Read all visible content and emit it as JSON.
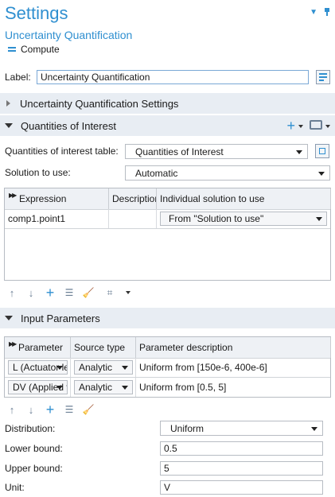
{
  "header": {
    "title": "Settings",
    "subtitle": "Uncertainty Quantification",
    "compute_label": "Compute"
  },
  "label_field": {
    "label": "Label:",
    "value": "Uncertainty Quantification"
  },
  "sections": {
    "uq_settings": "Uncertainty Quantification Settings",
    "qoi": "Quantities of Interest",
    "input_params": "Input Parameters"
  },
  "qoi": {
    "table_label": "Quantities of interest table:",
    "table_value": "Quantities of Interest",
    "solution_label": "Solution to use:",
    "solution_value": "Automatic",
    "columns": [
      "Expression",
      "Description",
      "Individual solution to use"
    ],
    "rows": [
      {
        "expression": "comp1.point1",
        "description": "",
        "solution": "From \"Solution to use\""
      }
    ]
  },
  "input_parameters": {
    "columns": [
      "Parameter",
      "Source type",
      "Parameter description"
    ],
    "rows": [
      {
        "parameter": "L (Actuator length)",
        "source": "Analytic",
        "description": "Uniform from [150e-6, 400e-6]"
      },
      {
        "parameter": "DV (Applied voltage)",
        "source": "Analytic",
        "description": "Uniform from [0.5, 5]"
      }
    ]
  },
  "distribution": {
    "distribution_label": "Distribution:",
    "distribution_value": "Uniform",
    "lower_label": "Lower bound:",
    "lower_value": "0.5",
    "upper_label": "Upper bound:",
    "upper_value": "5",
    "unit_label": "Unit:",
    "unit_value": "V"
  },
  "colors": {
    "accent": "#2f8fd0",
    "section_bg": "#e8edf3"
  }
}
